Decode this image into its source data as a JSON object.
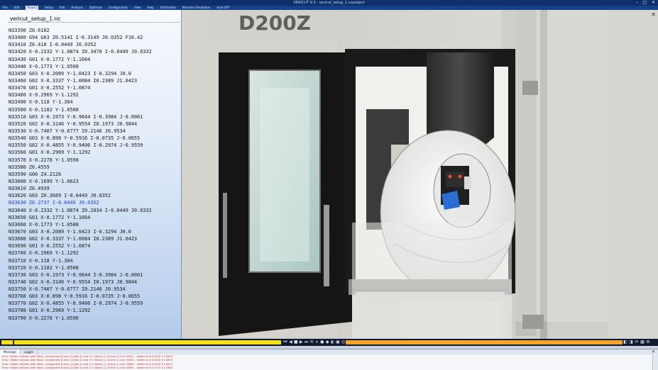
{
  "window": {
    "title": "VERICUT 9.3  -  vericut_setup_1.vcproject",
    "controls": [
      "–",
      "□",
      "✕"
    ]
  },
  "menu": {
    "items": [
      "File",
      "Edit",
      "Project",
      "Setup",
      "Info",
      "Analysis",
      "Optimize",
      "Configuration",
      "View",
      "Help",
      "Verification",
      "Machine Simulation",
      "Auto-Diff"
    ],
    "active_index": 2
  },
  "nc_panel": {
    "title": "vericut_setup_1.nc",
    "current_line_index": 24,
    "lines": [
      "N33390 Z0.6102",
      "N33400 G94 G03 Z0.5141 I-0.3149 J0.0352 F10.42",
      "N33410 Z0.418 I-0.0449 J0.0352",
      "N33420 X-0.2332 Y-1.0874 Z0.3478 I-0.0449 J0.0332",
      "N33430 G01 X-0.1772 Y-1.1664",
      "N33440 X-0.1773 Y-1.0508",
      "N33450 G03 X-0.2089 Y-1.0423 I-0.3294 J0.0",
      "N33460 G02 X-0.3337 Y-1.0084 I0.2389 J1.0423",
      "N33470 G01 X-0.2552 Y-1.0874",
      "N33480 X-0.2969 Y-1.1292",
      "N33490 X-0.118 Y-1.304",
      "N33500 X-0.1182 Y-1.0508",
      "N33510 G03 X-0.1973 Y-0.9644 I-0.3984 J-0.0001",
      "N33520 G02 X-0.3146 Y-0.9554 I0.1973 J0.9844",
      "N33530 X-0.7407 Y-0.6777 I0.2146 J0.9534",
      "N33540 G03 X-0.898 Y-0.5916 I-0.0735 J-0.0655",
      "N33550 G02 X-0.4855 Y-0.9406 I-0.2974 J-0.9559",
      "N33560 G01 X-0.2969 Y-1.1292",
      "N33570 X-0.2278 Y-1.0598",
      "N33580 Z0.4559",
      "N33590 G00 Z4.2126",
      "N33600 X-0.1699 Y-1.0623",
      "N33610 Z0.4939",
      "N33620 G03 Z0.3689 I-0.0449 J0.0352",
      "N33630 Z0.2737 I-0.0449 J0.0352",
      "N33640 X-0.2332 Y-1.0874 Z0.2034 I-0.0449 J0.0332",
      "N33650 G01 X-0.1772 Y-1.1664",
      "N33660 X-0.1773 Y-1.0508",
      "N33670 G03 X-0.2089 Y-1.0423 I-0.3294 J0.0",
      "N33680 G02 X-0.3337 Y-1.0084 I0.2389 J1.0423",
      "N33690 G01 X-0.2552 Y-1.0874",
      "N33700 X-0.2969 Y-1.1292",
      "N33710 X-0.118 Y-1.304",
      "N33720 X-0.1182 Y-1.0508",
      "N33730 G03 X-0.1973 Y-0.9644 I-0.3984 J-0.0001",
      "N33740 G02 X-0.3146 Y-0.9554 I0.1973 J0.9844",
      "N33750 X-0.7407 Y-0.6777 I0.2146 J0.9534",
      "N33760 G03 X-0.898 Y-0.5916 I-0.0735 J-0.0655",
      "N33770 G02 X-0.4855 Y-0.9406 I-0.2974 J-0.9559",
      "N33780 G01 X-0.2969 Y-1.1292",
      "N33790 X-0.2278 Y-1.0596"
    ]
  },
  "viewport": {
    "machine_label": "D200Z",
    "close_glyph": "✕"
  },
  "playback": {
    "progress": 0.04,
    "track_left_color": "#f2e21c",
    "track_right_color": "#f7a42a",
    "controls": [
      "⏮",
      "◀",
      "■",
      "▶",
      "⏭",
      "⟲",
      "⏸",
      "●",
      "◆",
      "◐",
      "▣",
      "◎"
    ],
    "right_controls": [
      "◧",
      "◨",
      "⟳",
      "▦",
      "⚙"
    ]
  },
  "messages": {
    "tabs": [
      "Message",
      "Logger"
    ],
    "active_tab": 0,
    "close_glyph": "✕",
    "lines": [
      "Error: Holder collision with Stock, Component B-axis (1)(Tool-1) and (11 (Stock_1) (Check-1) Line 33411 - holder at X-0.2332 Y-1.0874",
      "Error: Holder collision with Stock, Component B-axis (1)(Tool-1) and (11 (Stock_1) (Check-1) Line 33631 - holder at X-0.2332 Y-1.0874",
      "Error: Holder collision with Stock, Component B-axis (1)(Tool-1) and (11 (Stock_1) (Check-1) Line 33641 - holder at X-0.2332 Y-1.0874",
      "Error: Holder collision with Stock, Component B-axis (1)(Tool-1) and (11 (Stock_1) (Check-1) Line 33651 - holder at X-0.1772 Y-1.1664"
    ]
  }
}
